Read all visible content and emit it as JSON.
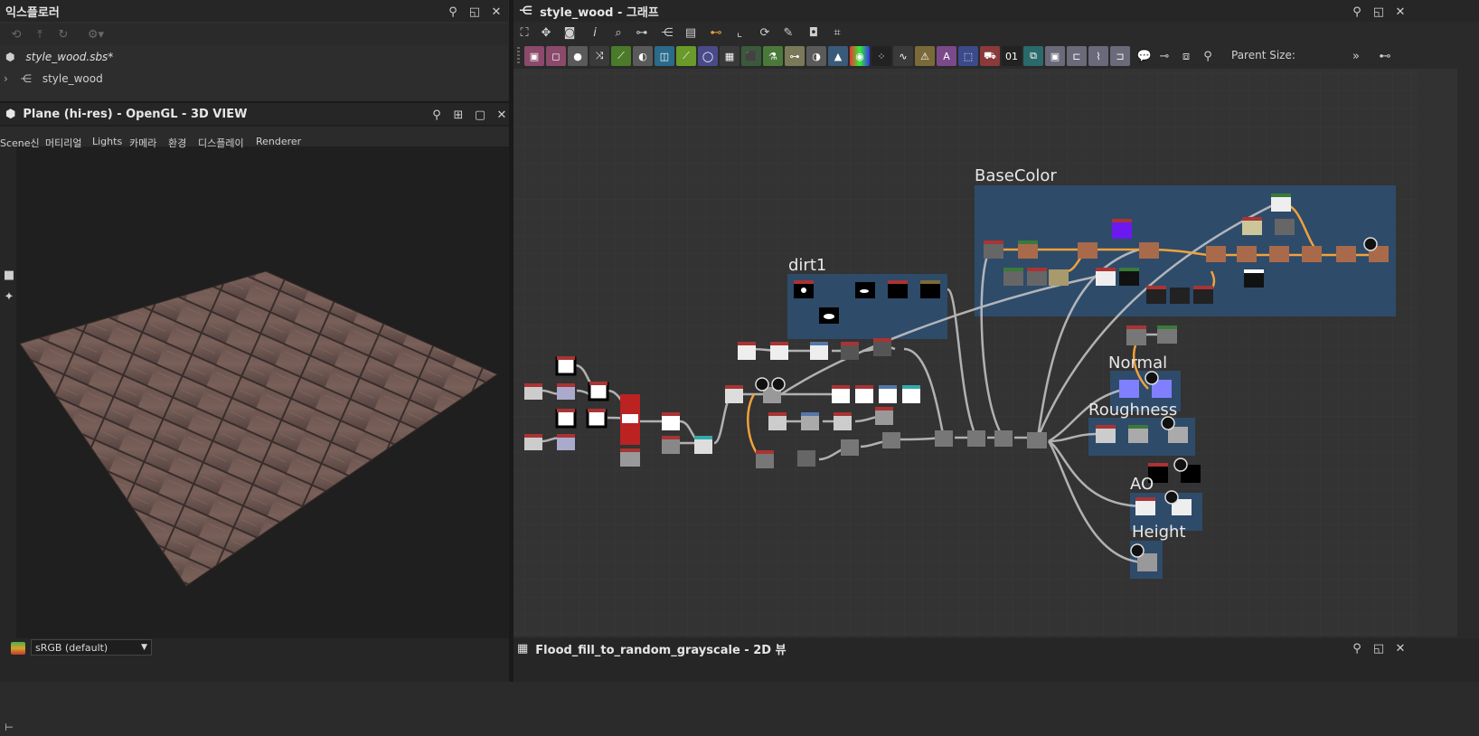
{
  "explorer": {
    "title": "익스플로러",
    "package_name": "style_wood.sbs*",
    "graph_name": "style_wood"
  },
  "viewport3d": {
    "title": "Plane (hi-res) - OpenGL - 3D VIEW",
    "menu": [
      "Scene신",
      "머티리얼",
      "Lights",
      "카메라",
      "환경",
      "디스플레이",
      "Renderer"
    ],
    "colorspace": "sRGB (default)"
  },
  "graph": {
    "title": "style_wood - 그래프",
    "parent_size_label": "Parent Size:",
    "groups": {
      "basecolor": "BaseColor",
      "dirt1": "dirt1",
      "normal": "Normal",
      "roughness": "Roughness",
      "ao": "AO",
      "height": "Height"
    }
  },
  "view2d": {
    "title": "Flood_fill_to_random_grayscale - 2D 뷰"
  },
  "icons": {
    "pin": "pin-icon",
    "float": "float-icon",
    "maximize": "maximize-icon",
    "close": "close-icon"
  },
  "colors": {
    "accent_orange": "#f0a23a",
    "group_blue": "#2d4e70",
    "toolbar_bg": "#3a3a3a"
  }
}
